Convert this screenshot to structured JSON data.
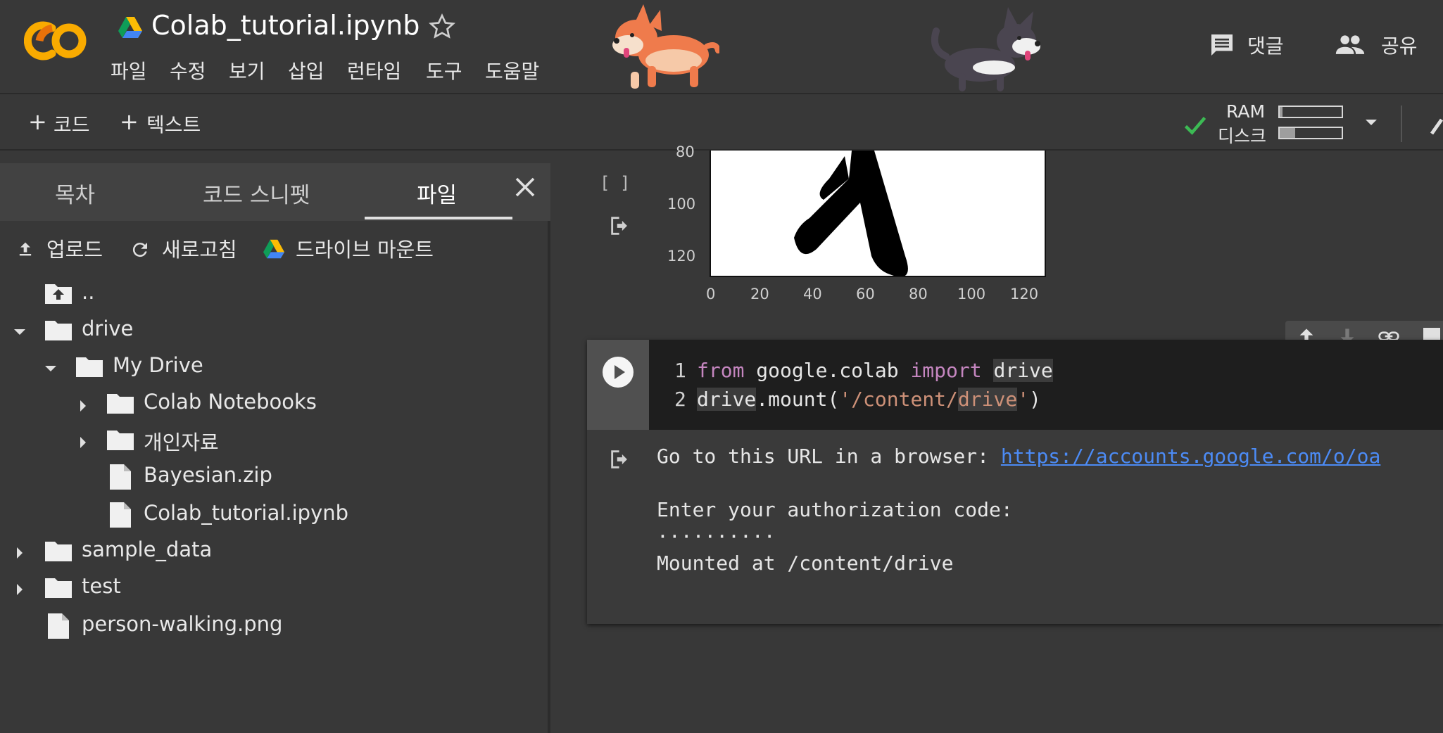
{
  "header": {
    "logo": "CO",
    "title": "Colab_tutorial.ipynb",
    "menu": [
      "파일",
      "수정",
      "보기",
      "삽입",
      "런타임",
      "도구",
      "도움말"
    ],
    "comment_label": "댓글",
    "share_label": "공유"
  },
  "toolbar": {
    "add_code": "코드",
    "add_text": "텍스트",
    "ram_label": "RAM",
    "disk_label": "디스크",
    "ram_usage": 0.05,
    "disk_usage": 0.25
  },
  "sidepanel": {
    "tabs": [
      "목차",
      "코드 스니펫",
      "파일"
    ],
    "actions": {
      "upload": "업로드",
      "refresh": "새로고침",
      "mount": "드라이브 마운트"
    },
    "tree": [
      {
        "label": "..",
        "type": "up"
      },
      {
        "label": "drive",
        "type": "folder",
        "expanded": true
      },
      {
        "label": "My Drive",
        "type": "folder",
        "expanded": true
      },
      {
        "label": "Colab Notebooks",
        "type": "folder",
        "expanded": false
      },
      {
        "label": "개인자료",
        "type": "folder",
        "expanded": false
      },
      {
        "label": "Bayesian.zip",
        "type": "file"
      },
      {
        "label": "Colab_tutorial.ipynb",
        "type": "file"
      },
      {
        "label": "sample_data",
        "type": "folder",
        "expanded": false
      },
      {
        "label": "test",
        "type": "folder",
        "expanded": false
      },
      {
        "label": "person-walking.png",
        "type": "file"
      }
    ]
  },
  "prev_cell": {
    "bracket": "[ ]",
    "y_ticks": [
      "80",
      "100",
      "120"
    ],
    "x_ticks": [
      "0",
      "20",
      "40",
      "60",
      "80",
      "100",
      "120"
    ]
  },
  "code_cell": {
    "line_numbers": [
      "1",
      "2"
    ],
    "line1": {
      "kw_from": "from",
      "mod": " google.colab ",
      "kw_import": "import",
      "sp": " ",
      "name": "drive"
    },
    "line2": {
      "obj": "drive",
      "call": ".mount(",
      "str_a": "'/content/",
      "str_b": "drive",
      "str_c": "'",
      "close": ")"
    }
  },
  "output": {
    "line1_prefix": "Go to this URL in a browser: ",
    "line1_link": "https://accounts.google.com/o/oa",
    "line2": "Enter your authorization code:",
    "line3": "··········",
    "line4": "Mounted at /content/drive"
  }
}
